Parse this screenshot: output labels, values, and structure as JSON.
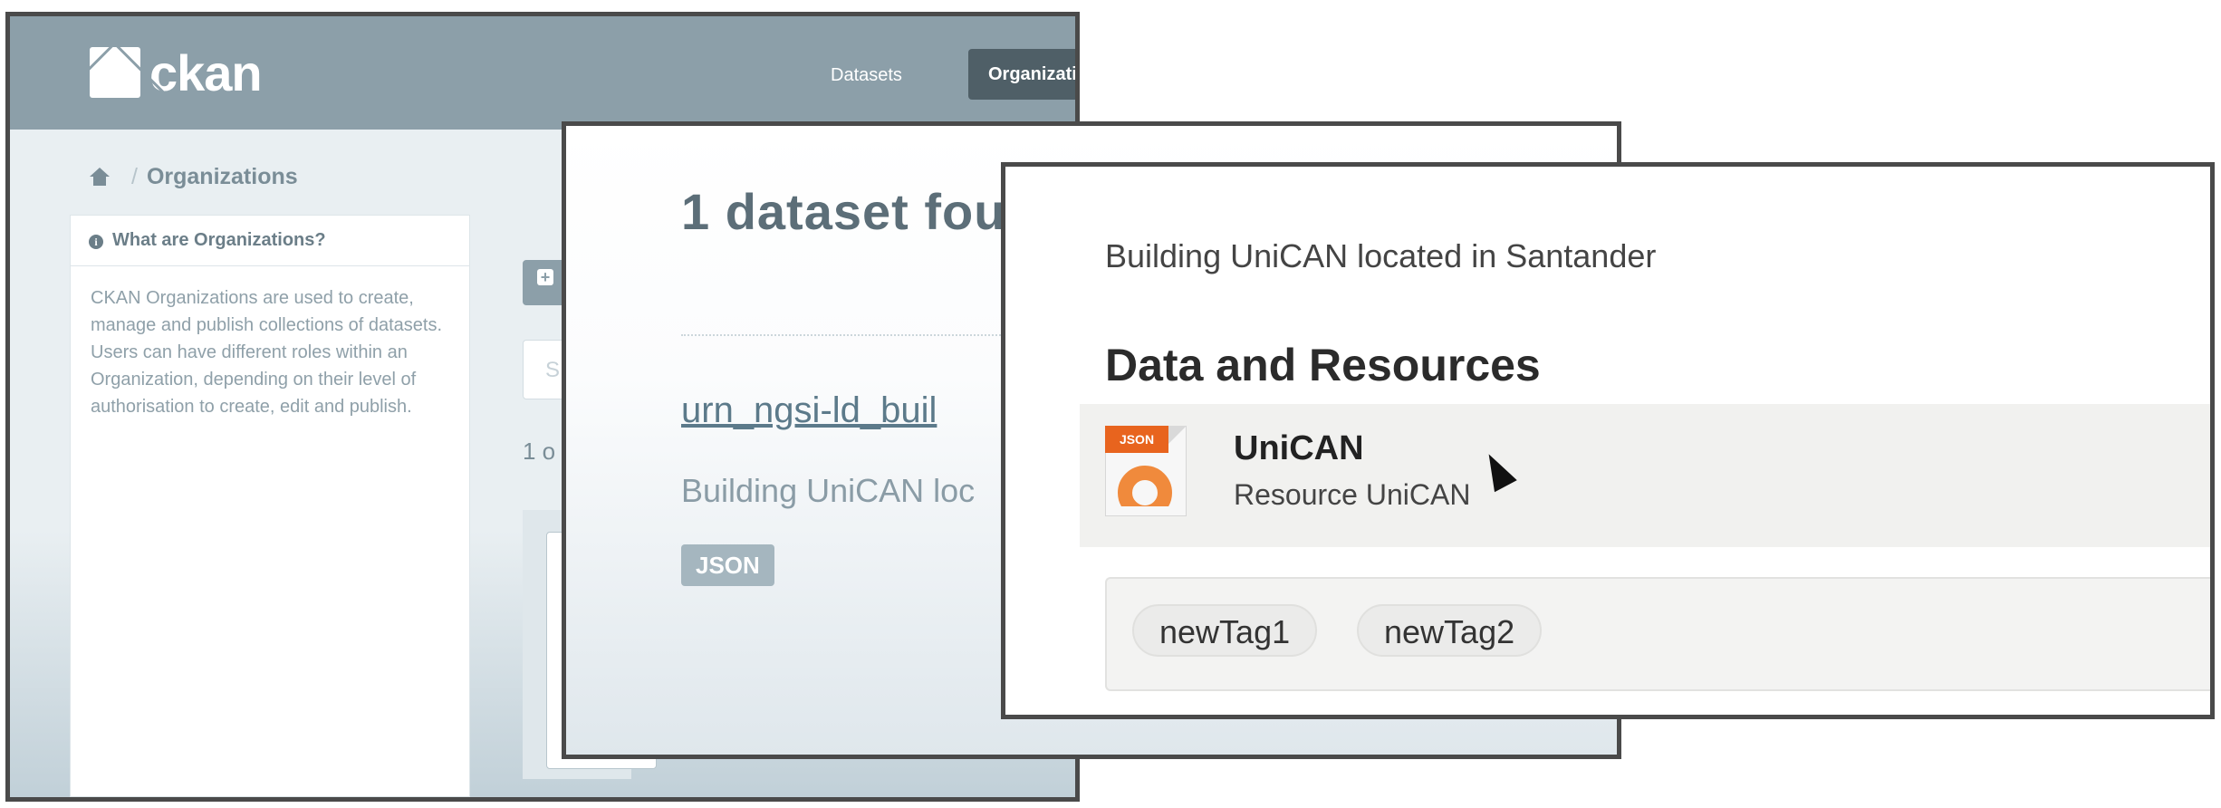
{
  "ckan": {
    "logo_text": "ckan",
    "nav": {
      "datasets": "Datasets",
      "organizations": "Organizati"
    },
    "breadcrumb": {
      "current": "Organizations"
    },
    "sidebar": {
      "title": "What are Organizations?",
      "body": "CKAN Organizations are used to create, manage and publish collections of datasets. Users can have different roles within an Organization, depending on their level of authorisation to create, edit and publish."
    },
    "search_placeholder": "S",
    "count_text": "1 o"
  },
  "search": {
    "title": "1 dataset fou",
    "result_link": "urn_ngsi-ld_buil",
    "result_desc": "Building UniCAN loc",
    "format_badge": "JSON"
  },
  "dataset": {
    "description": "Building UniCAN located in Santander",
    "section_heading": "Data and Resources",
    "resource": {
      "format": "JSON",
      "name": "UniCAN",
      "description": "Resource UniCAN"
    },
    "tags": [
      "newTag1",
      "newTag2"
    ]
  }
}
